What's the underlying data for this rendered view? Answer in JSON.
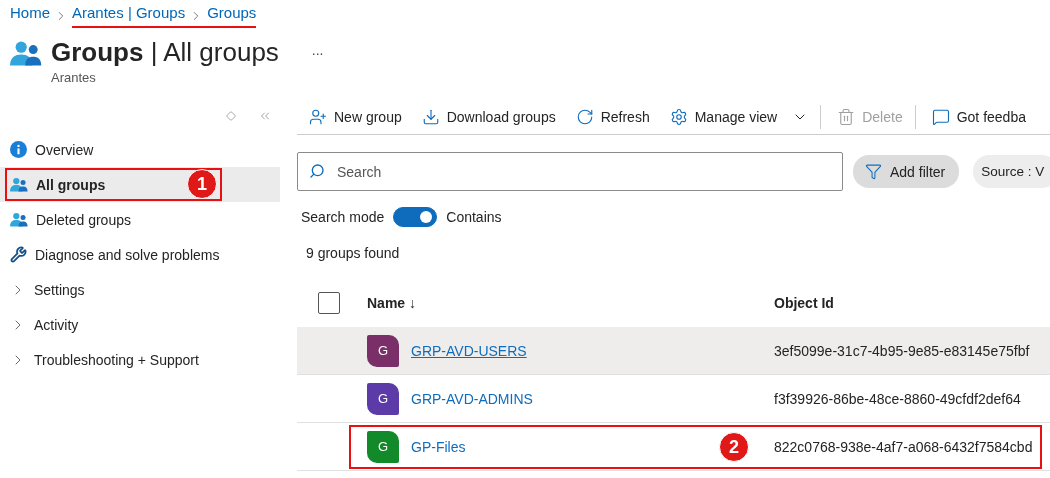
{
  "breadcrumb": [
    {
      "label": "Home",
      "annotated": false
    },
    {
      "label": "Arantes | Groups",
      "annotated": true
    },
    {
      "label": "Groups",
      "annotated": true
    }
  ],
  "header": {
    "title": "**Groups** | All groups",
    "subtitle": "Arantes",
    "more": "..."
  },
  "sidebar": {
    "items": [
      {
        "label": "Overview",
        "kind": "info",
        "selected": false
      },
      {
        "label": "All groups",
        "kind": "groups",
        "selected": true,
        "annotation": "1"
      },
      {
        "label": "Deleted groups",
        "kind": "groups",
        "selected": false
      },
      {
        "label": "Diagnose and solve problems",
        "kind": "wrench",
        "selected": false
      },
      {
        "label": "Settings",
        "kind": "folder",
        "selected": false
      },
      {
        "label": "Activity",
        "kind": "folder",
        "selected": false
      },
      {
        "label": "Troubleshooting + Support",
        "kind": "folder",
        "selected": false
      }
    ]
  },
  "toolbar": [
    {
      "label": "New group",
      "kind": "new",
      "disabled": false
    },
    {
      "label": "Download groups",
      "kind": "download",
      "disabled": false
    },
    {
      "label": "Refresh",
      "kind": "refresh",
      "disabled": false
    },
    {
      "label": "Manage view",
      "kind": "manage",
      "disabled": false
    },
    {
      "label": "Delete",
      "kind": "delete",
      "disabled": true
    },
    {
      "label": "Got feedba",
      "kind": "feedback",
      "disabled": false
    }
  ],
  "search": {
    "placeholder": "Search"
  },
  "filters": [
    {
      "label": "Add filter",
      "kind": "add"
    },
    {
      "label": "Source : V",
      "kind": "pill"
    }
  ],
  "search_mode": {
    "label": "Search mode",
    "on": true,
    "value": "Contains"
  },
  "count": "9 groups found",
  "table": {
    "select_all": {
      "checked": false
    },
    "columns": [
      "Name ↓",
      "Object Id"
    ],
    "rows": [
      {
        "initial": "G",
        "color": "#7a2f68",
        "name": "GRP-AVD-USERS",
        "object_id": "3ef5099e-31c7-4b95-9e85-e83145e75fbf",
        "hovered": true
      },
      {
        "initial": "G",
        "color": "#5c3ba8",
        "name": "GRP-AVD-ADMINS",
        "object_id": "f3f39926-86be-48ce-8860-49cfdf2def64",
        "hovered": false
      },
      {
        "initial": "G",
        "color": "#138a2a",
        "name": "GP-Files",
        "object_id": "822c0768-938e-4af7-a068-6432f7584cbd",
        "hovered": false,
        "annotation": "2"
      }
    ]
  }
}
